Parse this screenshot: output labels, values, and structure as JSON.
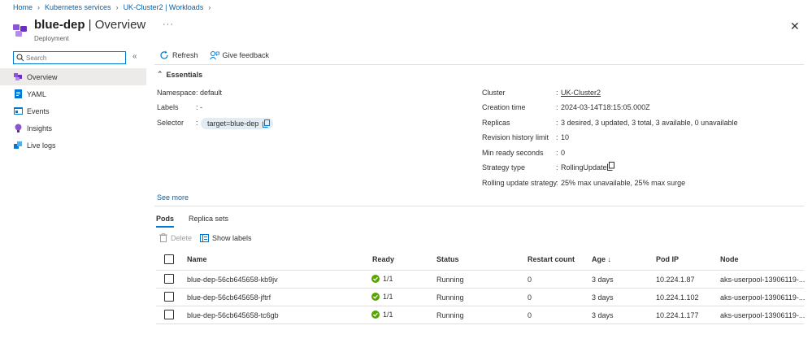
{
  "breadcrumb": [
    "Home",
    "Kubernetes services",
    "UK-Cluster2 | Workloads"
  ],
  "header": {
    "title_name": "blue-dep",
    "title_suffix": "| Overview",
    "subtitle": "Deployment",
    "more": "···",
    "close": "✕"
  },
  "sidebar": {
    "search_placeholder": "Search",
    "collapse": "«",
    "items": [
      {
        "label": "Overview",
        "icon": "overview-icon"
      },
      {
        "label": "YAML",
        "icon": "yaml-icon"
      },
      {
        "label": "Events",
        "icon": "events-icon"
      },
      {
        "label": "Insights",
        "icon": "insights-icon"
      },
      {
        "label": "Live logs",
        "icon": "live-logs-icon"
      }
    ]
  },
  "toolbar": {
    "refresh": "Refresh",
    "feedback": "Give feedback"
  },
  "essentials": {
    "header": "Essentials",
    "left": [
      {
        "label": "Namespace",
        "value": ": default"
      },
      {
        "label": "Labels",
        "value": ": -"
      },
      {
        "label": "Selector",
        "value": ":",
        "chip": "target=blue-dep"
      }
    ],
    "right": [
      {
        "label": "Cluster",
        "value": "UK-Cluster2"
      },
      {
        "label": "Creation time",
        "value": "2024-03-14T18:15:05.000Z"
      },
      {
        "label": "Replicas",
        "value": "3 desired, 3 updated, 3 total, 3 available, 0 unavailable"
      },
      {
        "label": "Revision history limit",
        "value": "10"
      },
      {
        "label": "Min ready seconds",
        "value": "0"
      },
      {
        "label": "Strategy type",
        "value": "RollingUpdate"
      },
      {
        "label": "Rolling update strategy",
        "value": "25% max unavailable, 25% max surge"
      }
    ],
    "see_more": "See more"
  },
  "tabs": [
    "Pods",
    "Replica sets"
  ],
  "pods_toolbar": {
    "delete": "Delete",
    "show_labels": "Show labels"
  },
  "table": {
    "columns": [
      "Name",
      "Ready",
      "Status",
      "Restart count",
      "Age ↓",
      "Pod IP",
      "Node"
    ],
    "rows": [
      {
        "name": "blue-dep-56cb645658-kb9jv",
        "ready": "1/1",
        "status": "Running",
        "restarts": "0",
        "age": "3 days",
        "ip": "10.224.1.87",
        "node": "aks-userpool-13906119-..."
      },
      {
        "name": "blue-dep-56cb645658-jftrf",
        "ready": "1/1",
        "status": "Running",
        "restarts": "0",
        "age": "3 days",
        "ip": "10.224.1.102",
        "node": "aks-userpool-13906119-..."
      },
      {
        "name": "blue-dep-56cb645658-tc6gb",
        "ready": "1/1",
        "status": "Running",
        "restarts": "0",
        "age": "3 days",
        "ip": "10.224.1.177",
        "node": "aks-userpool-13906119-..."
      }
    ]
  },
  "colors": {
    "link": "#0063b1",
    "accent": "#0078d4",
    "success": "#57a300",
    "resource_icon": "#7a3fc6"
  }
}
